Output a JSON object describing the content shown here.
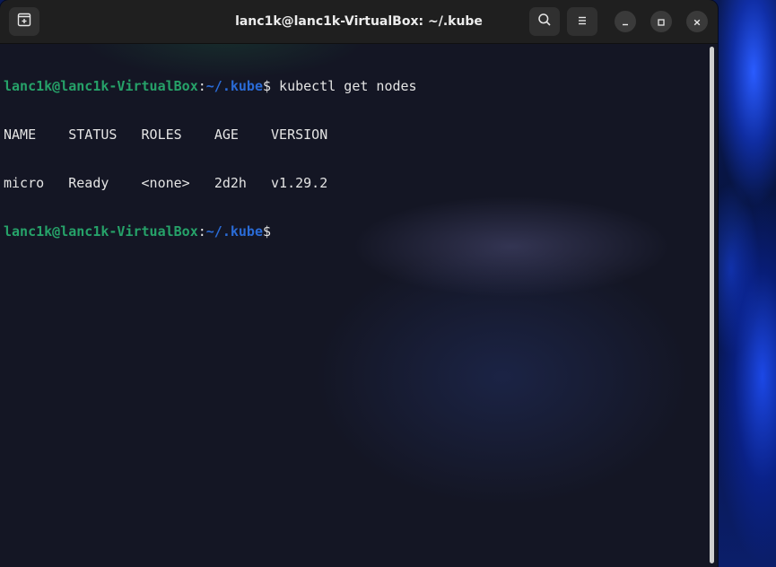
{
  "window": {
    "title": "lanc1k@lanc1k-VirtualBox: ~/.kube"
  },
  "titlebar": {
    "new_tab_icon": "new-tab-icon",
    "search_icon": "search-icon",
    "menu_icon": "hamburger-menu-icon",
    "minimize_icon": "minimize-icon",
    "maximize_icon": "maximize-icon",
    "close_icon": "close-icon"
  },
  "terminal": {
    "prompt1": {
      "user_host": "lanc1k@lanc1k-VirtualBox",
      "sep": ":",
      "path": "~/.kube",
      "symbol": "$",
      "command": " kubectl get nodes"
    },
    "header": {
      "name": "NAME",
      "status": "STATUS",
      "roles": "ROLES",
      "age": "AGE",
      "version": "VERSION"
    },
    "row": {
      "name": "micro",
      "status": "Ready",
      "roles": "<none>",
      "age": "2d2h",
      "version": "v1.29.2"
    },
    "prompt2": {
      "user_host": "lanc1k@lanc1k-VirtualBox",
      "sep": ":",
      "path": "~/.kube",
      "symbol": "$"
    }
  },
  "colors": {
    "prompt_user": "#26a269",
    "prompt_path": "#2a6bd6",
    "titlebar_bg": "#1f1f1f",
    "terminal_bg": "#141624"
  }
}
